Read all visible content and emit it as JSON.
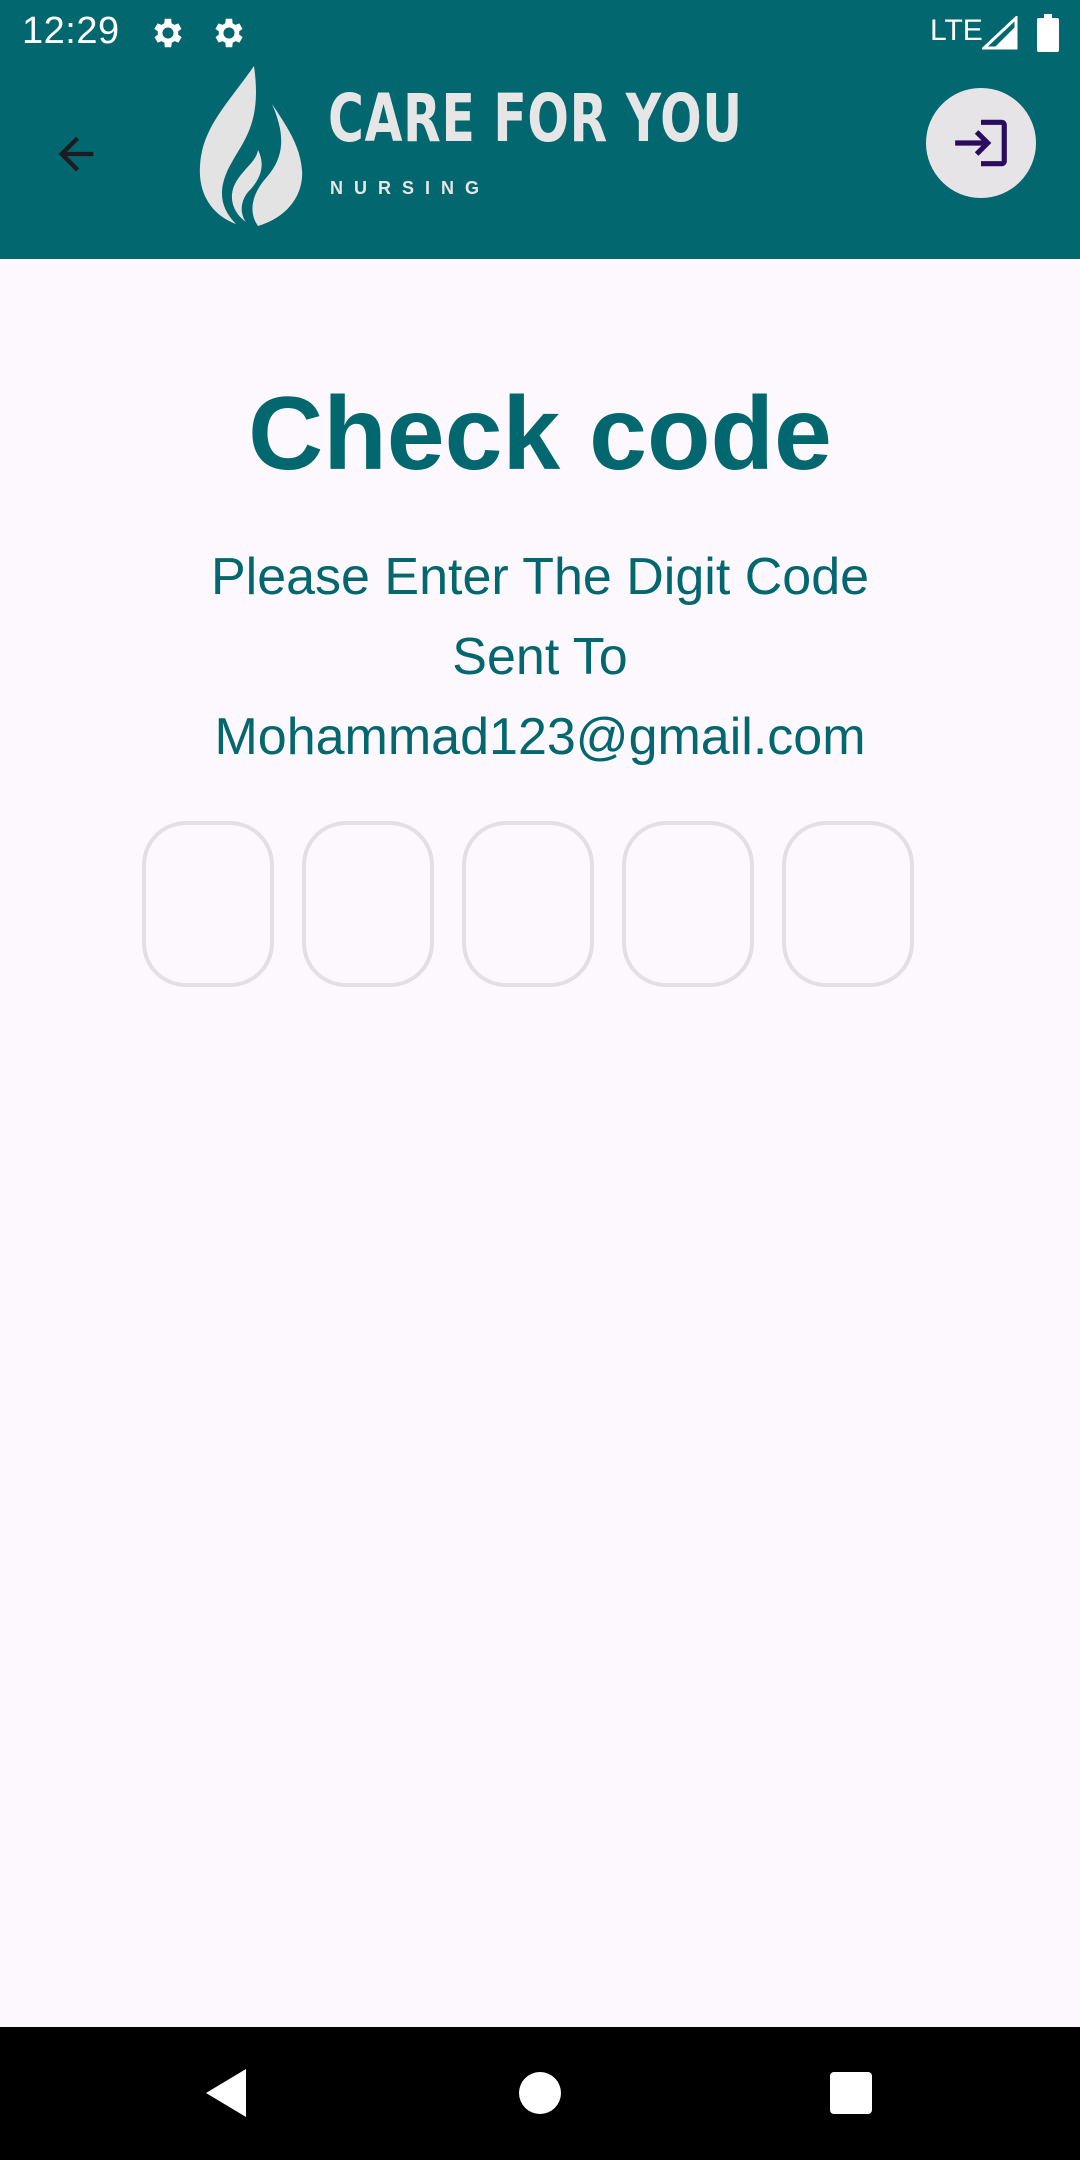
{
  "status_bar": {
    "time": "12:29",
    "network": "LTE"
  },
  "app_bar": {
    "logo_title": "CARE FOR YOU",
    "logo_subtitle": "NURSING",
    "back_icon": "arrow-left-icon",
    "login_icon": "login-enter-icon"
  },
  "main": {
    "title": "Check code",
    "instruction_line1": "Please Enter The Digit Code",
    "instruction_line2": "Sent To",
    "email": "Mohammad123@gmail.com",
    "code_boxes": [
      "",
      "",
      "",
      "",
      ""
    ]
  },
  "colors": {
    "brand_teal": "#02676f",
    "background": "#fdf8fd",
    "code_box_border": "#e2e0e3",
    "login_button_bg": "#e7e4e8",
    "login_icon": "#2a0b5e"
  },
  "nav_bar": {
    "back_icon": "nav-back-triangle-icon",
    "home_icon": "nav-home-circle-icon",
    "recents_icon": "nav-recents-square-icon"
  }
}
